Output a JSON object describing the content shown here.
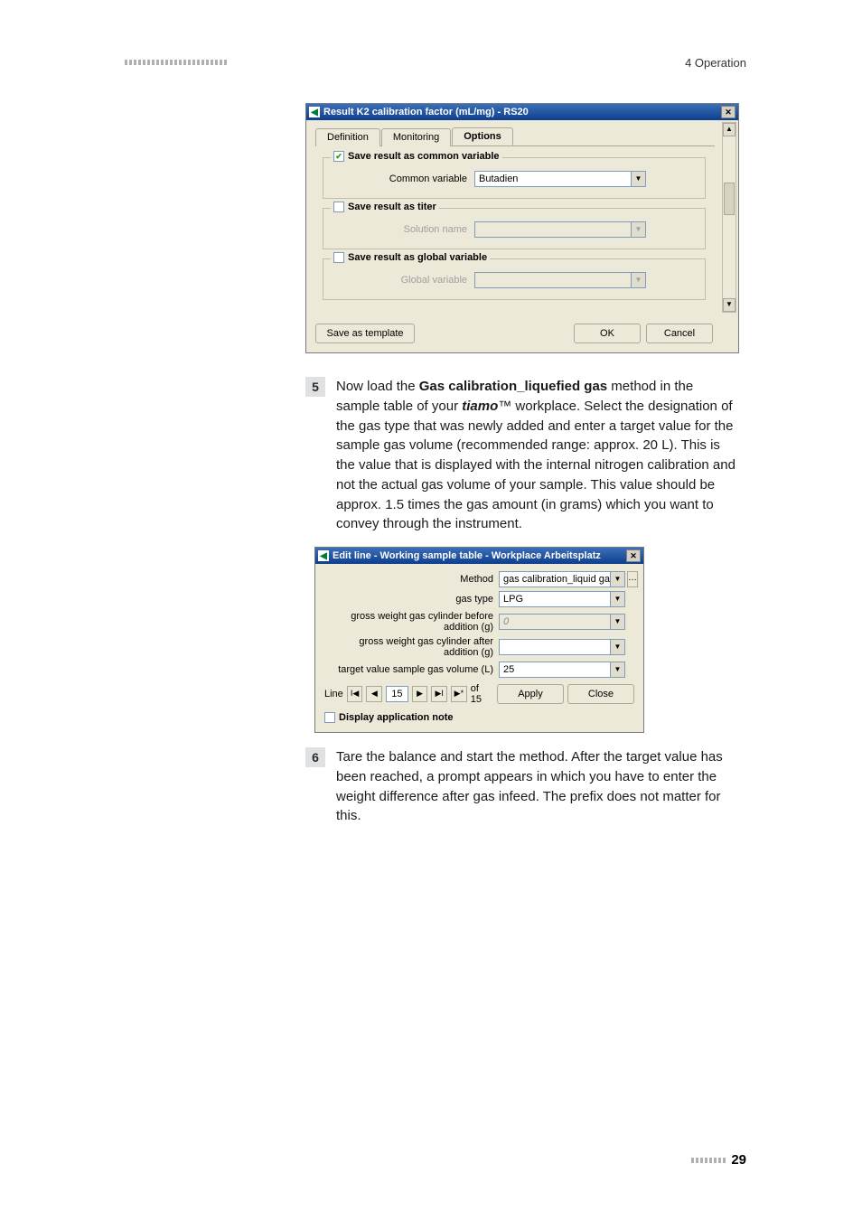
{
  "header": {
    "section": "4 Operation"
  },
  "dialog1": {
    "title": "Result K2 calibration factor (mL/mg) - RS20",
    "tabs": {
      "definition": "Definition",
      "monitoring": "Monitoring",
      "options": "Options"
    },
    "group1": {
      "legend": "Save result as common variable",
      "checked": true,
      "label": "Common variable",
      "value": "Butadien"
    },
    "group2": {
      "legend": "Save result as titer",
      "checked": false,
      "label": "Solution name",
      "value": ""
    },
    "group3": {
      "legend": "Save result as global variable",
      "checked": false,
      "label": "Global variable",
      "value": ""
    },
    "buttons": {
      "save_template": "Save as template",
      "ok": "OK",
      "cancel": "Cancel"
    }
  },
  "step5": {
    "num": "5",
    "text_pre": "Now load the ",
    "bold1": "Gas calibration_liquefied gas",
    "text_mid1": " method in the sample table of your ",
    "italic": "tiamo",
    "text_mid2": "™ workplace. Select the designation of the gas type that was newly added and enter a target value for the sample gas volume (recommended range: approx. 20 L). This is the value that is displayed with the internal nitrogen calibration and not the actual gas volume of your sample. This value should be approx. 1.5 times the gas amount (in grams) which you want to convey through the instrument."
  },
  "dialog2": {
    "title": "Edit line - Working sample table - Workplace Arbeitsplatz",
    "rows": {
      "method": {
        "label": "Method",
        "value": "gas calibration_liquid gas"
      },
      "gastype": {
        "label": "gas type",
        "value": "LPG"
      },
      "before": {
        "label": "gross weight gas cylinder before addition (g)",
        "value": "0"
      },
      "after": {
        "label": "gross weight gas cylinder after addition (g)",
        "value": ""
      },
      "target": {
        "label": "target value sample gas volume (L)",
        "value": "25"
      }
    },
    "nav": {
      "line_label": "Line",
      "current": "15",
      "of": "of 15"
    },
    "buttons": {
      "apply": "Apply",
      "close": "Close"
    },
    "appnote": "Display application note"
  },
  "step6": {
    "num": "6",
    "text": "Tare the balance and start the method. After the target value has been reached, a prompt appears in which you have to enter the weight difference after gas infeed. The prefix does not matter for this."
  },
  "footer": {
    "page": "29"
  }
}
